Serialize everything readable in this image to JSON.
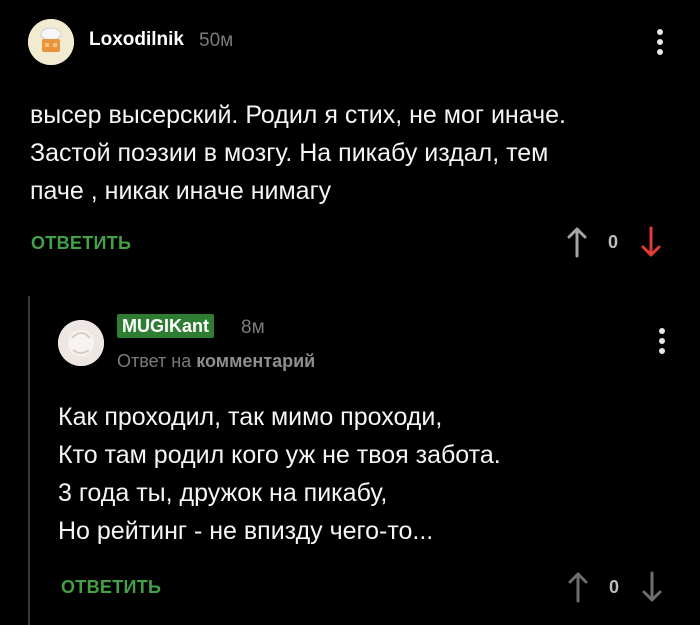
{
  "comments": [
    {
      "author": "Loxodilnik",
      "time": "50м",
      "lines": [
        "высер высерский. Родил я стих, не мог иначе.",
        "Застой поэзии в мозгу. На пикабу издал, тем",
        "паче ,  никак иначе нимагу"
      ],
      "reply_label": "ОТВЕТИТЬ",
      "rating": "0",
      "upvote_color": "#a6a6a6",
      "downvote_color": "#e53935"
    },
    {
      "author": "MUGIKant",
      "time": "8м",
      "reply_to_prefix": "Ответ на",
      "reply_to_link": "комментарий",
      "lines": [
        "Как проходил, так мимо проходи,",
        "Кто там родил кого уж не твоя забота.",
        "3 года ты, дружок на пикабу,",
        "Но рейтинг - не впизду чего-то..."
      ],
      "reply_label": "ОТВЕТИТЬ",
      "rating": "0",
      "upvote_color": "#6e6e6e",
      "downvote_color": "#6e6e6e"
    }
  ],
  "colors": {
    "accent_green": "#43a047",
    "badge_green": "#2e7d32",
    "background": "#000000"
  },
  "icons": {
    "more": "vertical-dots-icon",
    "upvote": "arrow-up-icon",
    "downvote": "arrow-down-icon"
  }
}
